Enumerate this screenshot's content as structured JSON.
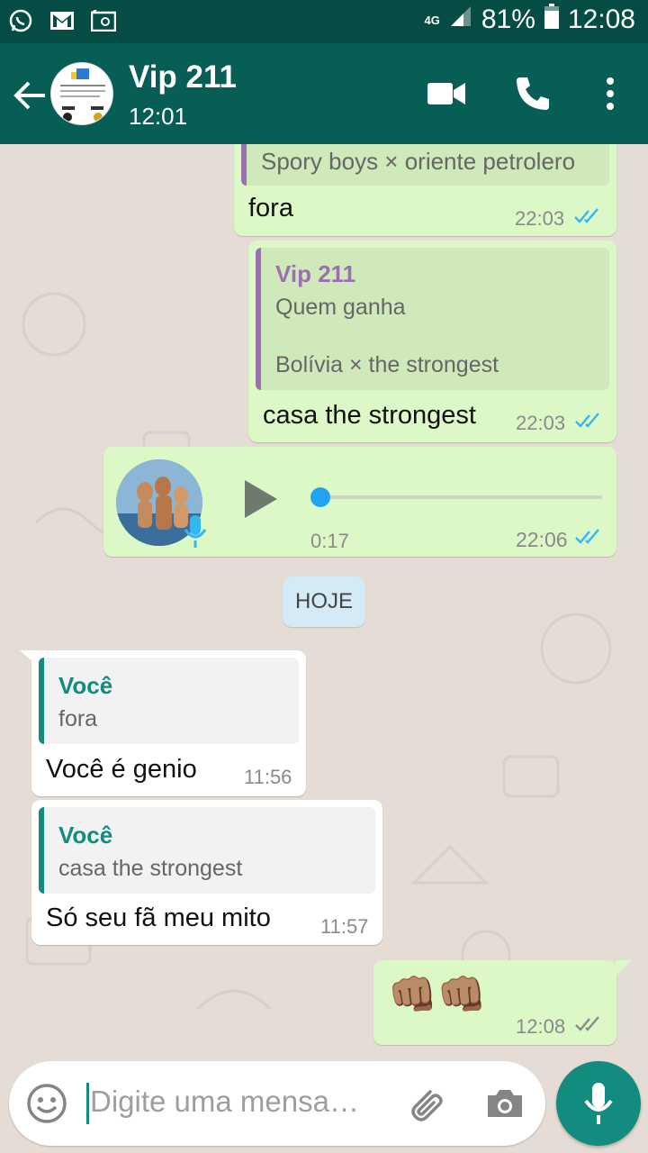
{
  "status_bar": {
    "network": "4G",
    "battery": "81%",
    "clock": "12:08"
  },
  "header": {
    "contact_name": "Vip 211",
    "subtitle": "12:01"
  },
  "messages": [
    {
      "quote_text": "Spory boys × oriente petrolero",
      "text": "fora",
      "time": "22:03"
    },
    {
      "quote_author": "Vip 211",
      "quote_line1": "Quem ganha",
      "quote_line2": "Bolívia  × the strongest",
      "text": "casa the strongest",
      "time": "22:03"
    },
    {
      "duration": "0:17",
      "time": "22:06"
    },
    {
      "quote_author": "Você",
      "quote_text": "fora",
      "text": "Você é  genio",
      "time": "11:56"
    },
    {
      "quote_author": "Você",
      "quote_text": "casa the strongest",
      "text": "Só seu fã meu mito",
      "time": "11:57"
    },
    {
      "text": "👊🏽👊🏽",
      "time": "12:08"
    }
  ],
  "date_divider": "HOJE",
  "input": {
    "placeholder": "Digite uma mensa…"
  },
  "colors": {
    "header": "#075e54",
    "status_bar": "#054d44",
    "outgoing": "#dcf8c6",
    "incoming": "#ffffff",
    "accent": "#128c7e",
    "read_tick": "#34b7f1"
  }
}
